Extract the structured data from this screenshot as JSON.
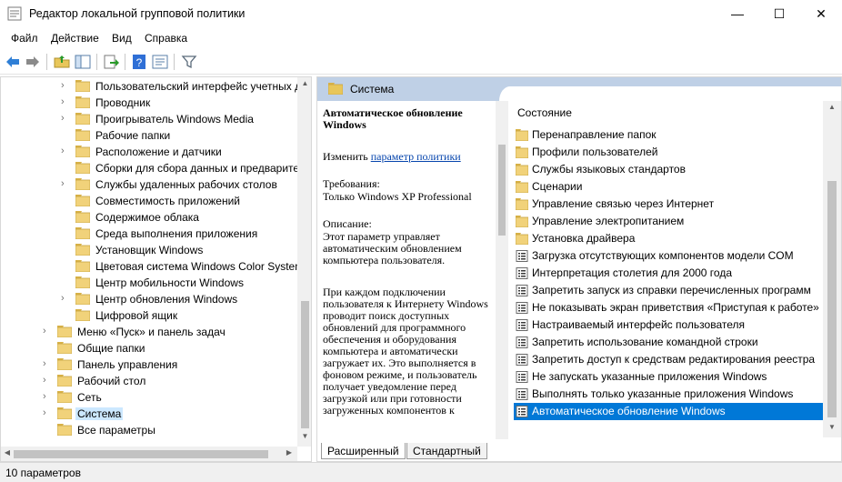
{
  "window": {
    "title": "Редактор локальной групповой политики",
    "minimize": "—",
    "maximize": "☐",
    "close": "✕"
  },
  "menu": [
    "Файл",
    "Действие",
    "Вид",
    "Справка"
  ],
  "tree": {
    "items": [
      {
        "label": "Пользовательский интерфейс учетных д",
        "expandable": true
      },
      {
        "label": "Проводник",
        "expandable": true
      },
      {
        "label": "Проигрыватель Windows Media",
        "expandable": true
      },
      {
        "label": "Рабочие папки",
        "expandable": false
      },
      {
        "label": "Расположение и датчики",
        "expandable": true
      },
      {
        "label": "Сборки для сбора данных и предварител",
        "expandable": false
      },
      {
        "label": "Службы удаленных рабочих столов",
        "expandable": true
      },
      {
        "label": "Совместимость приложений",
        "expandable": false
      },
      {
        "label": "Содержимое облака",
        "expandable": false
      },
      {
        "label": "Среда выполнения приложения",
        "expandable": false
      },
      {
        "label": "Установщик Windows",
        "expandable": false
      },
      {
        "label": "Цветовая система Windows Color System",
        "expandable": false
      },
      {
        "label": "Центр мобильности Windows",
        "expandable": false
      },
      {
        "label": "Центр обновления Windows",
        "expandable": true
      },
      {
        "label": "Цифровой ящик",
        "expandable": false
      },
      {
        "label": "Меню «Пуск» и панель задач",
        "expandable": true
      },
      {
        "label": "Общие папки",
        "expandable": false
      },
      {
        "label": "Панель управления",
        "expandable": true
      },
      {
        "label": "Рабочий стол",
        "expandable": true
      },
      {
        "label": "Сеть",
        "expandable": true
      },
      {
        "label": "Система",
        "expandable": true,
        "selected": true
      },
      {
        "label": "Все параметры",
        "expandable": false
      }
    ]
  },
  "header": {
    "folder": "Система"
  },
  "description": {
    "title": "Автоматическое обновление Windows",
    "edit_prefix": "Изменить",
    "edit_link": "параметр политики",
    "requirements_label": "Требования:",
    "requirements": "Только Windows XP Professional",
    "description_label": "Описание:",
    "body1": "Этот параметр управляет автоматическим обновлением компьютера пользователя.",
    "body2": "При каждом подключении пользователя к Интернету Windows проводит поиск доступных обновлений для программного обеспечения и оборудования компьютера и автоматически загружает их. Это выполняется в фоновом режиме, и пользователь получает уведомление перед загрузкой или при готовности загруженных компонентов к"
  },
  "list": {
    "column": "Состояние",
    "items": [
      {
        "label": "Перенаправление папок",
        "type": "folder"
      },
      {
        "label": "Профили пользователей",
        "type": "folder"
      },
      {
        "label": "Службы языковых стандартов",
        "type": "folder"
      },
      {
        "label": "Сценарии",
        "type": "folder"
      },
      {
        "label": "Управление связью через Интернет",
        "type": "folder"
      },
      {
        "label": "Управление электропитанием",
        "type": "folder"
      },
      {
        "label": "Установка драйвера",
        "type": "folder"
      },
      {
        "label": "Загрузка отсутствующих компонентов модели COM",
        "type": "setting"
      },
      {
        "label": "Интерпретация столетия для 2000 года",
        "type": "setting"
      },
      {
        "label": "Запретить запуск из справки перечисленных программ",
        "type": "setting"
      },
      {
        "label": "Не показывать экран приветствия «Приступая к работе»",
        "type": "setting"
      },
      {
        "label": "Настраиваемый интерфейс пользователя",
        "type": "setting"
      },
      {
        "label": "Запретить использование командной строки",
        "type": "setting"
      },
      {
        "label": "Запретить доступ к средствам редактирования реестра",
        "type": "setting"
      },
      {
        "label": "Не запускать указанные приложения Windows",
        "type": "setting"
      },
      {
        "label": "Выполнять только указанные приложения Windows",
        "type": "setting"
      },
      {
        "label": "Автоматическое обновление Windows",
        "type": "setting",
        "selected": true
      }
    ]
  },
  "tabs": [
    "Расширенный",
    "Стандартный"
  ],
  "status": "10 параметров",
  "colors": {
    "selection": "#0078d7",
    "tree_selection": "#cce8ff",
    "header": "#bfd0e6",
    "folder": "#e8c65a"
  }
}
